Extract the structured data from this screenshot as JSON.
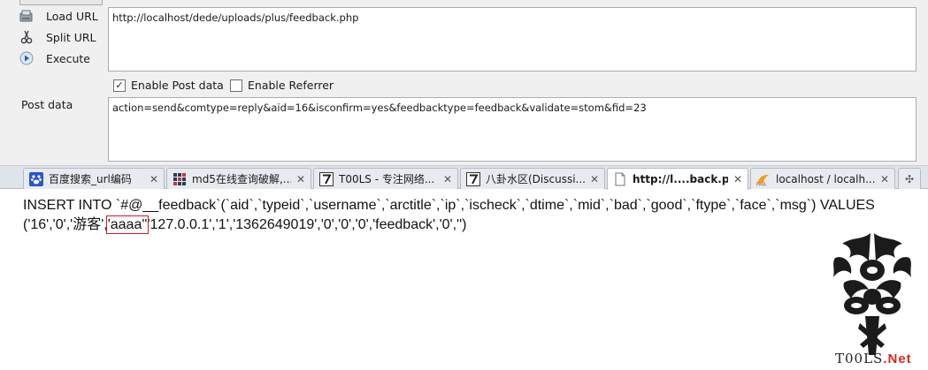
{
  "hackbar": {
    "load_url_label": "Load URL",
    "split_url_label": "Split URL",
    "execute_label": "Execute",
    "url_value": "http://localhost/dede/uploads/plus/feedback.php",
    "enable_post_label": "Enable Post data",
    "enable_post_checked": true,
    "enable_referrer_label": "Enable Referrer",
    "enable_referrer_checked": false,
    "post_data_label": "Post data",
    "post_data_value": "action=send&comtype=reply&aid=16&isconfirm=yes&feedbacktype=feedback&validate=stom&fid=23"
  },
  "tabs": [
    {
      "title": "百度搜索_url编码",
      "icon": "baidu-paw-icon",
      "close": "✕",
      "active": false
    },
    {
      "title": "md5在线查询破解,...",
      "icon": "grid-icon",
      "close": "✕",
      "active": false
    },
    {
      "title": "T00LS - 专注网络...",
      "icon": "number-7-icon",
      "close": "✕",
      "active": false
    },
    {
      "title": "八卦水区(Discussi...",
      "icon": "number-7-icon",
      "close": "✕",
      "active": false
    },
    {
      "title": "http://l....back.php",
      "icon": "page-icon",
      "close": "✕",
      "active": true
    },
    {
      "title": "localhost / localh...",
      "icon": "pma-icon",
      "close": "✕",
      "active": false
    }
  ],
  "new_tab_glyph": "✣",
  "content": {
    "line1": "INSERT INTO `#@__feedback`(`aid`,`typeid`,`username`,`arctitle`,`ip`,`ischeck`,`dtime`,`mid`,`bad`,`good`,`ftype`,`face`,`msg`) VALUES",
    "line2_before": "('16','0','游客',",
    "line2_highlight": "'aaaa''",
    "line2_after": "'127.0.0.1','1','1362649019','0','0','0','feedback','0','')"
  },
  "watermark": {
    "text": "T00LS",
    "suffix": ".Net",
    "accent_color": "#d42b1e"
  }
}
